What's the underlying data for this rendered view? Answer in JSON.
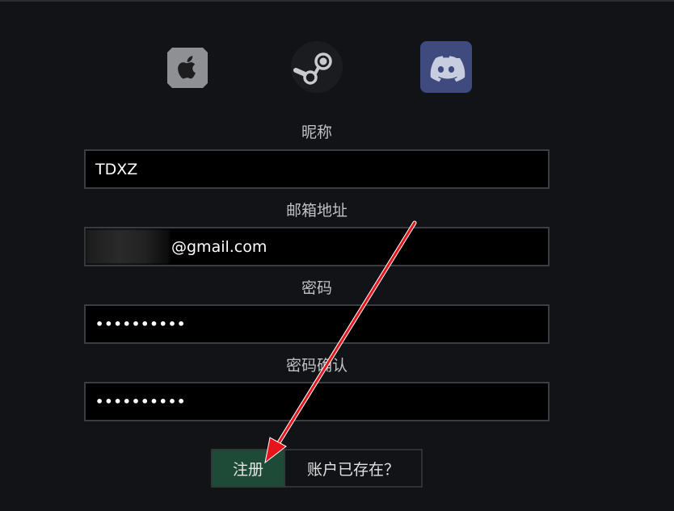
{
  "social": {
    "apple": {
      "icon": "apple-icon"
    },
    "steam": {
      "icon": "steam-icon"
    },
    "discord": {
      "icon": "discord-icon"
    }
  },
  "form": {
    "nickname_label": "昵称",
    "nickname_value": "TDXZ",
    "email_label": "邮箱地址",
    "email_value": "@gmail.com",
    "password_label": "密码",
    "password_value": "••••••••••",
    "confirm_label": "密码确认",
    "confirm_value": "••••••••••"
  },
  "actions": {
    "register_label": "注册",
    "have_account_label": "账户已存在？"
  },
  "colors": {
    "background": "#121317",
    "register_bg": "#1e4a38",
    "discord_bg": "#3f4a7e",
    "annotation_arrow": "#e8141c"
  }
}
